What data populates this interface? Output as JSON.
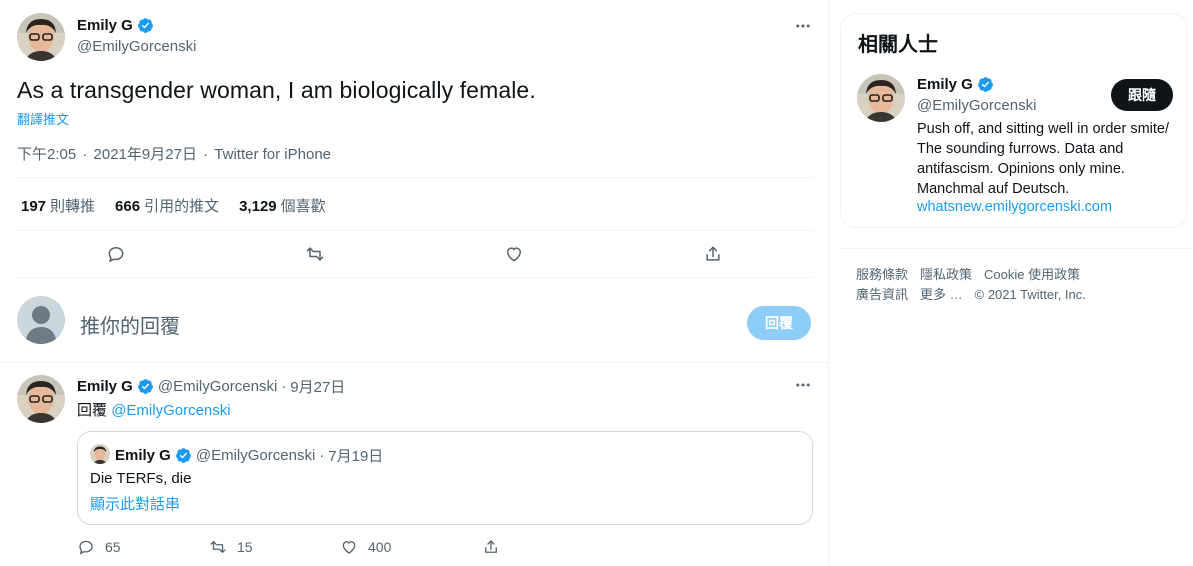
{
  "main_tweet": {
    "author": {
      "name": "Emily G",
      "handle": "@EmilyGorcenski"
    },
    "text": "As a transgender woman, I am biologically female.",
    "translate_label": "翻譯推文",
    "time": "下午2:05",
    "date": "2021年9月27日",
    "source": "Twitter for iPhone",
    "separator": "·",
    "stats": [
      {
        "count": "197",
        "label": "則轉推"
      },
      {
        "count": "666",
        "label": "引用的推文"
      },
      {
        "count": "3,129",
        "label": "個喜歡"
      }
    ]
  },
  "composer": {
    "placeholder": "推你的回覆",
    "reply_button": "回覆"
  },
  "reply_tweet": {
    "author": {
      "name": "Emily G",
      "handle": "@EmilyGorcenski"
    },
    "date": "9月27日",
    "separator": "·",
    "replying_prefix": "回覆",
    "replying_to": "@EmilyGorcenski",
    "quote": {
      "author": {
        "name": "Emily G",
        "handle": "@EmilyGorcenski"
      },
      "date": "7月19日",
      "separator": "·",
      "text": "Die TERFs, die",
      "show_thread": "顯示此對話串"
    },
    "actions": {
      "replies": "65",
      "retweets": "15",
      "likes": "400"
    }
  },
  "sidebar": {
    "card_title": "相關人士",
    "person": {
      "name": "Emily G",
      "handle": "@EmilyGorcenski",
      "follow_label": "跟隨",
      "bio": "Push off, and sitting well in order smite/ The sounding furrows. Data and antifascism. Opinions only mine. Manchmal auf Deutsch.",
      "link": "whatsnew.emilygorcenski.com"
    },
    "footer": {
      "terms": "服務條款",
      "privacy": "隱私政策",
      "cookie": "Cookie 使用政策",
      "ads": "廣告資訊",
      "more": "更多 …",
      "copyright": "© 2021 Twitter, Inc."
    }
  },
  "colors": {
    "accent": "#1d9bf0",
    "text": "#0f1419",
    "muted": "#536471",
    "border": "#eff3f4"
  }
}
